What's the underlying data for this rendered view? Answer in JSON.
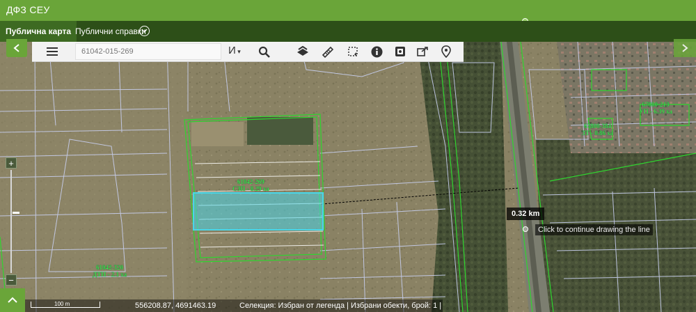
{
  "app": {
    "title": "ДФЗ СЕУ"
  },
  "nav": {
    "tabs": [
      {
        "label": "Публична карта"
      },
      {
        "label": "Публични справки"
      }
    ]
  },
  "toolbar": {
    "search_value": "61042-015-269",
    "search_operator": "И"
  },
  "map": {
    "measure_distance": "0.32 km",
    "measure_hint": "Click to continue drawing the line",
    "scale_label": "100 m",
    "coordinates": "556208.87, 4691463.19",
    "selection_status": "Селекция: Избран от легенда  |  Избрани обекти, брой: 1  |",
    "parcels": [
      {
        "line1": "61042-269",
        "line2": "СЗП - 8.29 ха"
      },
      {
        "line1": "61042-320",
        "line2": "ДТН - 2.1 ха"
      },
      {
        "line1": "67800-213",
        "line2": "УП - 6.39 ха"
      },
      {
        "line1": "67800-384",
        "line2": "ЗТ - 0.86 ха"
      }
    ]
  },
  "colors": {
    "topbar": "#6aa539",
    "navbar": "#2d4f18",
    "parcel_selected": "#49d6e8",
    "parcel_outline": "#2fd52f"
  }
}
